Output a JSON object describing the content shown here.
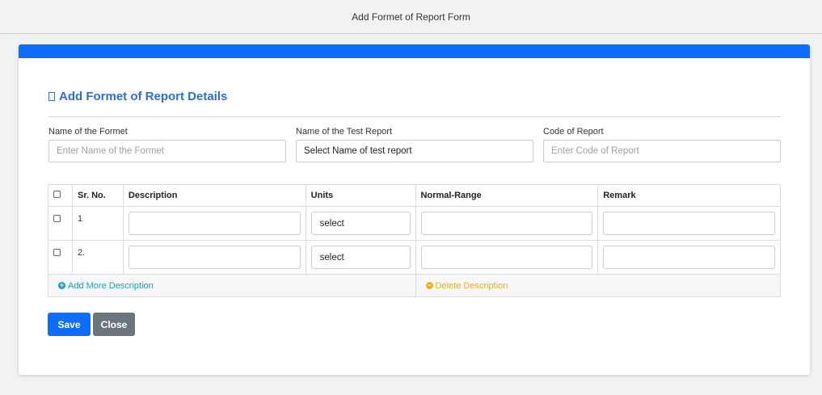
{
  "page": {
    "title": "Add Formet of Report Form"
  },
  "section": {
    "title": "Add Formet of Report Details"
  },
  "fields": {
    "formet_name": {
      "label": "Name of the Formet",
      "placeholder": "Enter Name of the Formet",
      "value": ""
    },
    "test_report": {
      "label": "Name of the Test Report",
      "placeholder": "",
      "value": "Select Name of test report"
    },
    "report_code": {
      "label": "Code of Report",
      "placeholder": "Enter Code of Report",
      "value": ""
    }
  },
  "table": {
    "headers": {
      "sr": "Sr. No.",
      "description": "Description",
      "units": "Units",
      "range": "Normal-Range",
      "remark": "Remark"
    },
    "rows": [
      {
        "sr": "1",
        "units": "select"
      },
      {
        "sr": "2.",
        "units": "select"
      }
    ],
    "add_label": "Add More Description",
    "delete_label": "Delete Description"
  },
  "buttons": {
    "save": "Save",
    "close": "Close"
  },
  "colors": {
    "primary": "#0d6efd",
    "secondary": "#6c757d",
    "info": "#17a2b8",
    "warning": "#f0ad1a",
    "title": "#2a6fd6"
  }
}
